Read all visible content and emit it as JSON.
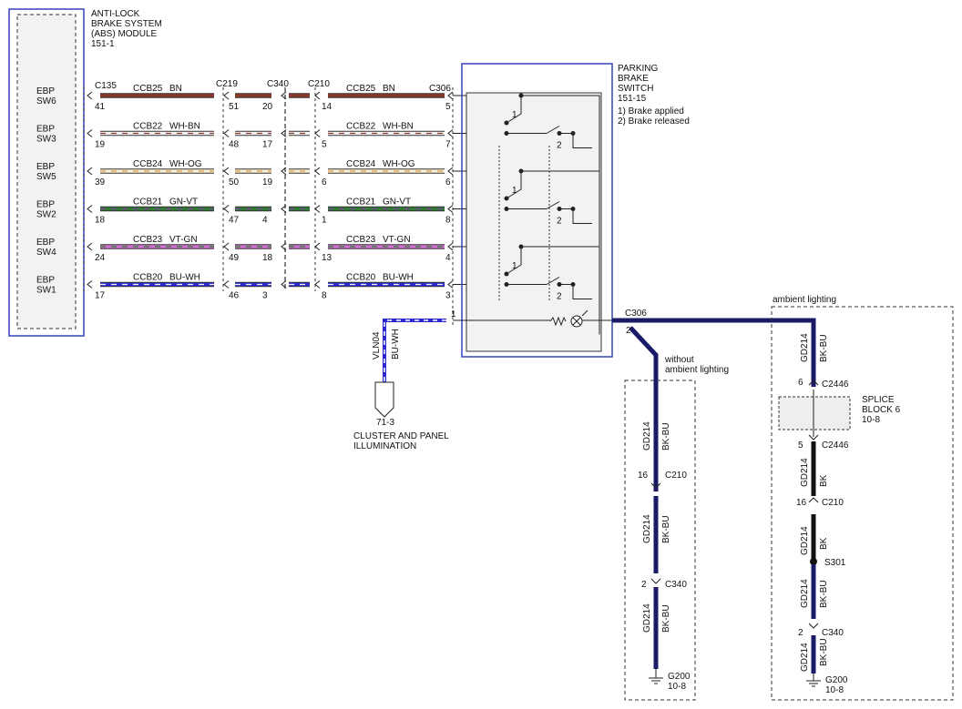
{
  "abs_module": {
    "title": [
      "ANTI-LOCK",
      "BRAKE SYSTEM",
      "(ABS) MODULE",
      "151-1"
    ]
  },
  "parking_switch": {
    "title": [
      "PARKING",
      "BRAKE",
      "SWITCH",
      "151-15"
    ],
    "notes": [
      "1) Brake applied",
      "2) Brake released"
    ]
  },
  "connectors": {
    "c135": "C135",
    "c219": "C219",
    "c340": "C340",
    "c210": "C210",
    "c306": "C306",
    "c306_b": "C306"
  },
  "rows": [
    {
      "pin_label": [
        "EBP",
        "SW6"
      ],
      "left_wire": "CCB25",
      "left_color": "BN",
      "right_wire": "CCB25",
      "right_color": "BN",
      "pins": [
        "41",
        "51",
        "20",
        "14",
        "5"
      ],
      "sw": "SW6",
      "c1": "#8b3a2a",
      "c2": "#8b3a2a"
    },
    {
      "pin_label": [
        "EBP",
        "SW3"
      ],
      "left_wire": "CCB22",
      "left_color": "WH-BN",
      "right_wire": "CCB22",
      "right_color": "WH-BN",
      "pins": [
        "19",
        "48",
        "17",
        "5",
        "7"
      ],
      "sw": "SW3",
      "c1": "#f4f4f4",
      "c2": "#8b3a2a"
    },
    {
      "pin_label": [
        "EBP",
        "SW5"
      ],
      "left_wire": "CCB24",
      "left_color": "WH-OG",
      "right_wire": "CCB24",
      "right_color": "WH-OG",
      "pins": [
        "39",
        "50",
        "19",
        "6",
        "6"
      ],
      "sw": "SW5",
      "c1": "#f6f0d8",
      "c2": "#e8a040"
    },
    {
      "pin_label": [
        "EBP",
        "SW2"
      ],
      "left_wire": "CCB21",
      "left_color": "GN-VT",
      "right_wire": "CCB21",
      "right_color": "GN-VT",
      "pins": [
        "18",
        "47",
        "4",
        "1",
        "8"
      ],
      "sw": "SW2",
      "c1": "#2e7d32",
      "c2": "#7b3fa0"
    },
    {
      "pin_label": [
        "EBP",
        "SW4"
      ],
      "left_wire": "CCB23",
      "left_color": "VT-GN",
      "right_wire": "CCB23",
      "right_color": "VT-GN",
      "pins": [
        "24",
        "49",
        "18",
        "13",
        "4"
      ],
      "sw": "SW4",
      "c1": "#d070d0",
      "c2": "#2e7d32"
    },
    {
      "pin_label": [
        "EBP",
        "SW1"
      ],
      "left_wire": "CCB20",
      "left_color": "BU-WH",
      "right_wire": "CCB20",
      "right_color": "BU-WH",
      "pins": [
        "17",
        "46",
        "3",
        "8",
        "3"
      ],
      "sw": "SW1",
      "c1": "#2a2ad0",
      "c2": "#f4f4f4"
    }
  ],
  "illum": {
    "pin": "1",
    "wire": "VLN04",
    "color": "BU-WH",
    "ref": "71-3",
    "label": [
      "CLUSTER AND PANEL",
      "ILLUMINATION"
    ]
  },
  "ground_out": {
    "pin": "2"
  },
  "without_ambient": {
    "label": [
      "without",
      "ambient lighting"
    ],
    "segments": [
      {
        "wire": "GD214",
        "color": "BK-BU"
      },
      {
        "wire": "GD214",
        "color": "BK-BU"
      },
      {
        "wire": "GD214",
        "color": "BK-BU"
      }
    ],
    "c210": {
      "pin": "16",
      "name": "C210"
    },
    "c340": {
      "pin": "2",
      "name": "C340"
    },
    "ground": {
      "name": "G200",
      "ref": "10-8"
    }
  },
  "ambient": {
    "label": "ambient lighting",
    "segments": [
      {
        "wire": "GD214",
        "color": "BK-BU"
      },
      {
        "wire": "GD214",
        "color": "BK"
      },
      {
        "wire": "GD214",
        "color": "BK"
      },
      {
        "wire": "GD214",
        "color": "BK-BU"
      },
      {
        "wire": "GD214",
        "color": "BK-BU"
      }
    ],
    "c2446_top": {
      "pin": "6",
      "name": "C2446"
    },
    "c2446_bot": {
      "pin": "5",
      "name": "C2446"
    },
    "splice_block": [
      "SPLICE",
      "BLOCK 6",
      "10-8"
    ],
    "c210": {
      "pin": "16",
      "name": "C210"
    },
    "splice": "S301",
    "c340": {
      "pin": "2",
      "name": "C340"
    },
    "ground": {
      "name": "G200",
      "ref": "10-8"
    }
  }
}
